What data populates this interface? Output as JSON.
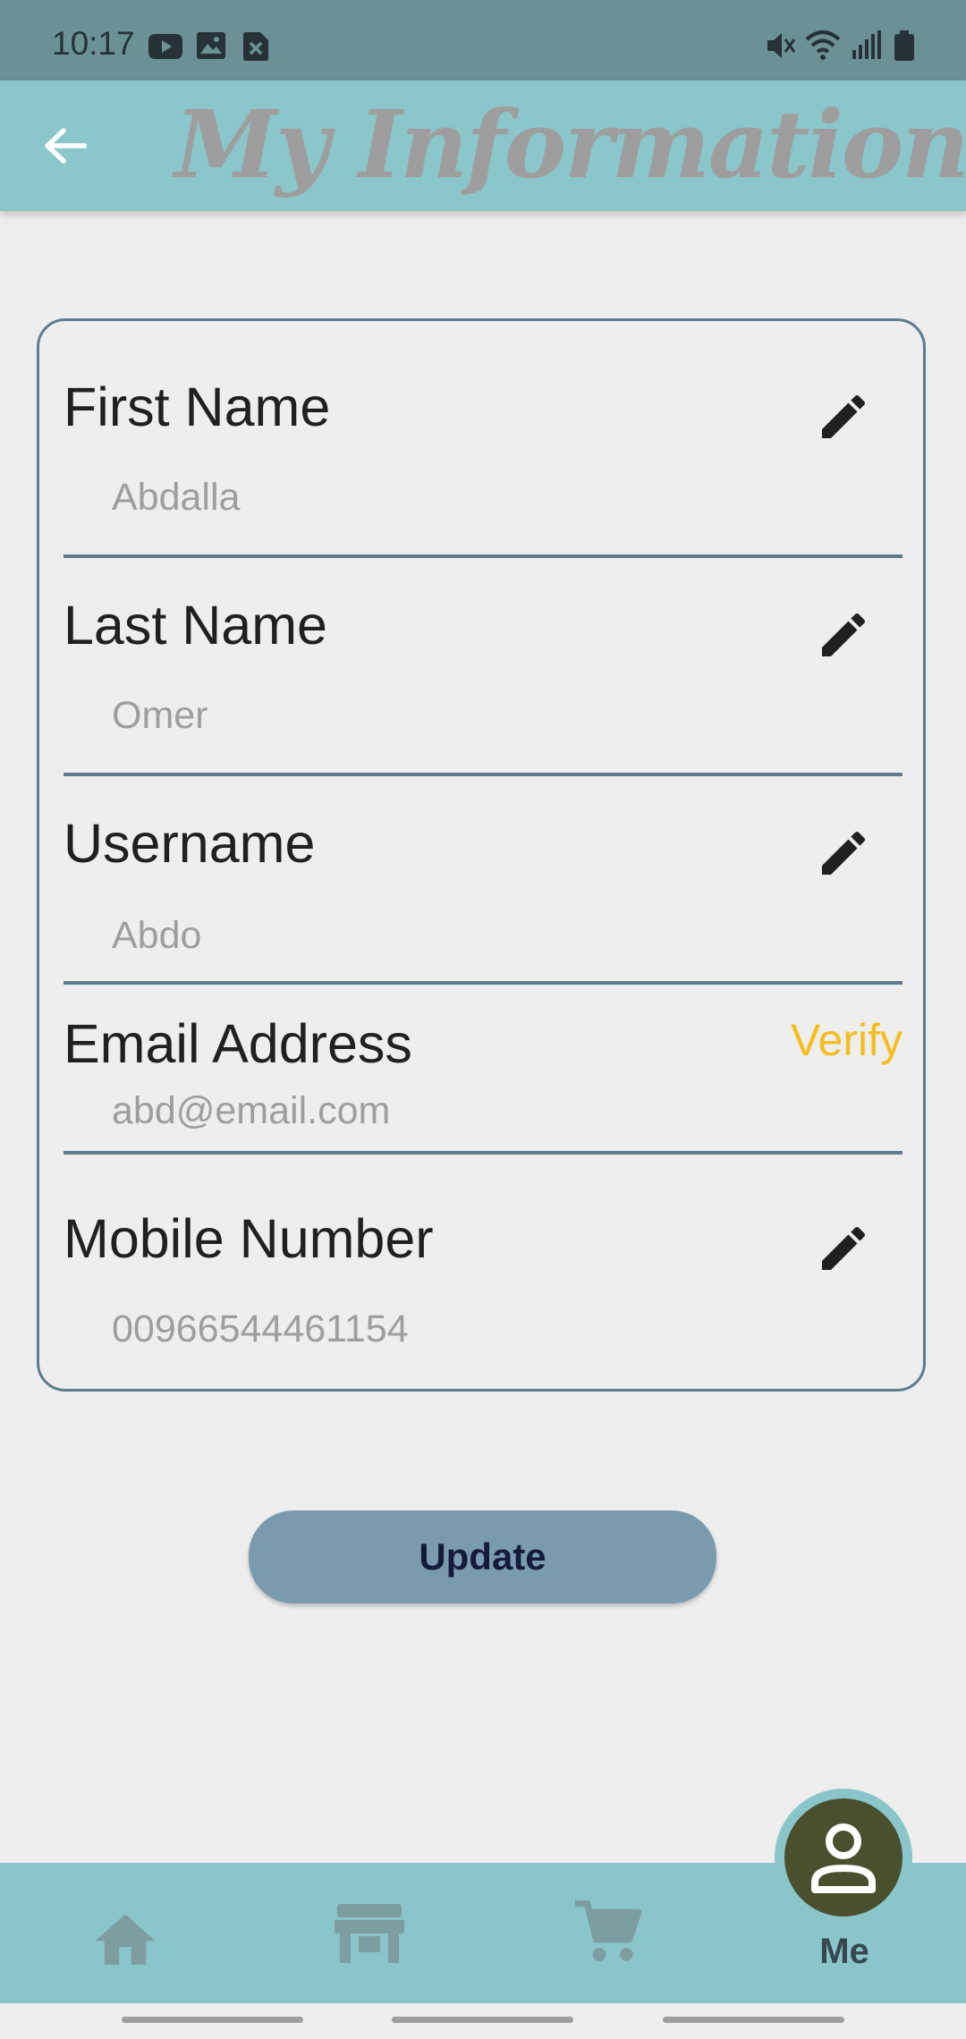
{
  "status_bar": {
    "time": "10:17",
    "left_icons": [
      "youtube-icon",
      "gallery-icon",
      "doc-icon"
    ],
    "right_icons": [
      "mute-icon",
      "wifi-icon",
      "signal-icon",
      "battery-icon"
    ]
  },
  "app_bar": {
    "title": "My Information",
    "back_icon": "arrow-left-icon"
  },
  "form": {
    "fields": [
      {
        "label": "First Name",
        "value": "Abdalla",
        "action": "edit"
      },
      {
        "label": "Last Name",
        "value": "Omer",
        "action": "edit"
      },
      {
        "label": "Username",
        "value": "Abdo",
        "action": "edit"
      },
      {
        "label": "Email Address",
        "value": "abd@email.com",
        "action_label": "Verify"
      },
      {
        "label": "Mobile Number",
        "value": "00966544461154",
        "action": "edit"
      }
    ],
    "edit_icon": "pencil-icon"
  },
  "update_button": {
    "label": "Update"
  },
  "bottom_nav": {
    "items": [
      {
        "icon": "home-icon"
      },
      {
        "icon": "store-icon"
      },
      {
        "icon": "cart-icon"
      },
      {
        "icon": "person-icon",
        "label": "Me",
        "active": true
      }
    ]
  },
  "colors": {
    "status_bar": "#6B9195",
    "app_bar": "#8BC6CA",
    "card_border": "#5E7C8E",
    "verify": "#F5BE1E",
    "update_button": "#7A9BAE",
    "nav_bar": "#8AC5C9",
    "active_avatar": "#4A4F2E"
  }
}
